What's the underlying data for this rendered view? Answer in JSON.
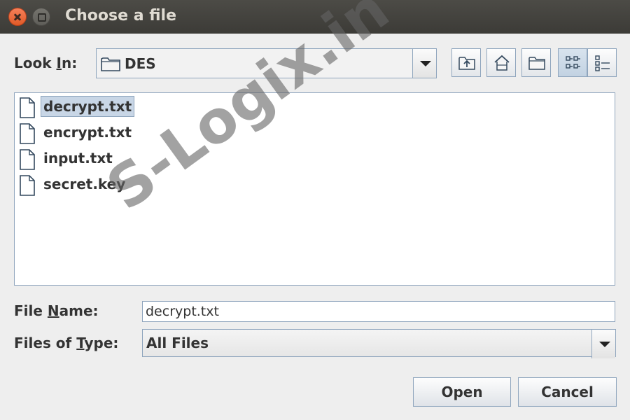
{
  "window": {
    "title": "Choose a file"
  },
  "look_in": {
    "label_pre": "Look ",
    "label_mnemonic": "I",
    "label_post": "n:",
    "value": "DES"
  },
  "toolbar": {
    "icons": [
      "up-one-level-icon",
      "home-icon",
      "new-folder-icon",
      "list-view-icon",
      "details-view-icon"
    ],
    "selected_view": "list"
  },
  "files": [
    {
      "name": "decrypt.txt",
      "selected": true
    },
    {
      "name": "encrypt.txt",
      "selected": false
    },
    {
      "name": "input.txt",
      "selected": false
    },
    {
      "name": "secret.key",
      "selected": false
    }
  ],
  "file_name": {
    "label_pre": "File ",
    "label_mnemonic": "N",
    "label_post": "ame:",
    "value": "decrypt.txt"
  },
  "file_type": {
    "label_pre": "Files of ",
    "label_mnemonic": "T",
    "label_post": "ype:",
    "value": "All Files"
  },
  "buttons": {
    "open": "Open",
    "cancel": "Cancel"
  },
  "watermark": "S-Logix.in",
  "colors": {
    "titlebar": "#3c3b37",
    "close": "#e4602f",
    "border": "#8fa5bd",
    "selection": "#c8d6e6"
  }
}
